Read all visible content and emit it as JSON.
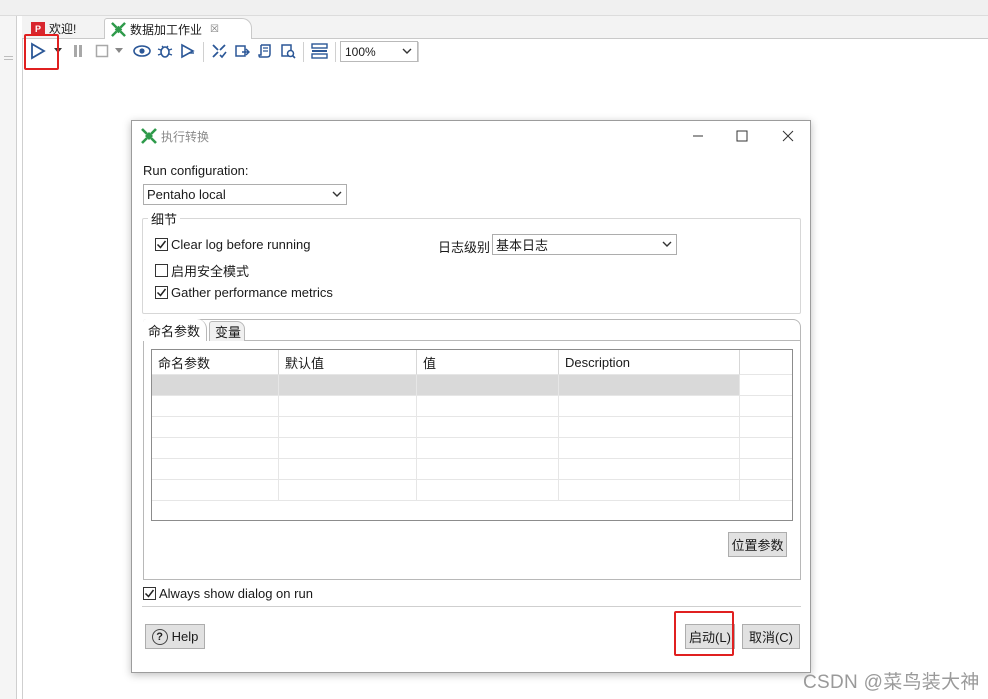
{
  "app": {
    "tabs": [
      {
        "label": "欢迎!",
        "icon": "welcome-logo-icon"
      },
      {
        "label": "数据加工作业",
        "icon": "job-icon",
        "close": "☒"
      }
    ]
  },
  "toolbar": {
    "zoom": "100%",
    "icons": [
      "run-icon",
      "run-dropdown-icon",
      "pause-icon",
      "stop-icon",
      "stop-dropdown-icon",
      "preview-icon",
      "debug-icon",
      "replay-icon",
      "verify-icon",
      "impact-icon",
      "sql-icon",
      "explore-db-icon",
      "show-results-icon"
    ]
  },
  "dialog": {
    "title": "执行转换",
    "run_config_label": "Run configuration:",
    "run_config_value": "Pentaho local",
    "details_group": "细节",
    "clear_log": {
      "label": "Clear log before running",
      "checked": true
    },
    "safe_mode": {
      "label": "启用安全模式",
      "checked": false
    },
    "gather_metrics": {
      "label": "Gather performance metrics",
      "checked": true
    },
    "log_level_label": "日志级别",
    "log_level_value": "基本日志",
    "tabs": [
      "命名参数",
      "变量"
    ],
    "grid": {
      "columns": [
        "命名参数",
        "默认值",
        "值",
        "Description"
      ],
      "rows": [
        [
          "",
          "",
          "",
          ""
        ],
        [
          "",
          "",
          "",
          ""
        ],
        [
          "",
          "",
          "",
          ""
        ],
        [
          "",
          "",
          "",
          ""
        ],
        [
          "",
          "",
          "",
          ""
        ],
        [
          "",
          "",
          "",
          ""
        ]
      ]
    },
    "position_params_button": "位置参数",
    "always_show": {
      "label": "Always show dialog on run",
      "checked": true
    },
    "help_button": "Help",
    "start_button": "启动(L)",
    "cancel_button": "取消(C)"
  },
  "watermark": "CSDN @菜鸟装大神",
  "colors": {
    "highlight": "#e02020",
    "kettle_green": "#2e9a4a",
    "selected_row": "#d9d9d9"
  }
}
